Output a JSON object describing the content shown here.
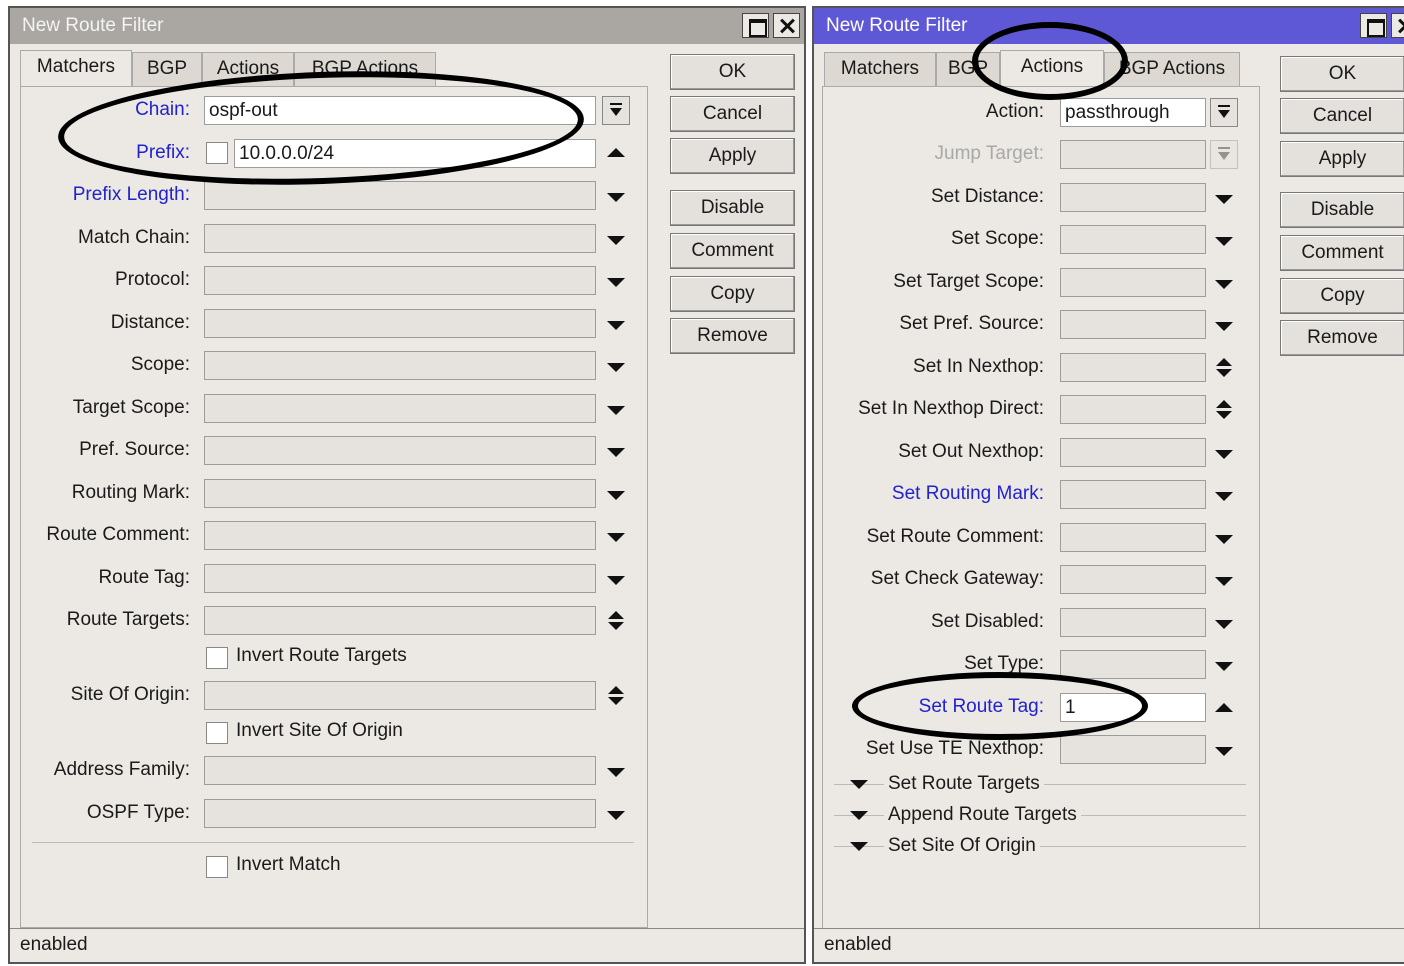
{
  "left_window": {
    "title": "New Route Filter",
    "tabs": [
      "Matchers",
      "BGP",
      "Actions",
      "BGP Actions"
    ],
    "active_tab": "Matchers",
    "fields": {
      "chain": {
        "label": "Chain:",
        "value": "ospf-out"
      },
      "prefix": {
        "label": "Prefix:",
        "value": "10.0.0.0/24"
      },
      "prefix_length": {
        "label": "Prefix Length:",
        "value": ""
      },
      "match_chain": {
        "label": "Match Chain:",
        "value": ""
      },
      "protocol": {
        "label": "Protocol:",
        "value": ""
      },
      "distance": {
        "label": "Distance:",
        "value": ""
      },
      "scope": {
        "label": "Scope:",
        "value": ""
      },
      "target_scope": {
        "label": "Target Scope:",
        "value": ""
      },
      "pref_source": {
        "label": "Pref. Source:",
        "value": ""
      },
      "routing_mark": {
        "label": "Routing Mark:",
        "value": ""
      },
      "route_comment": {
        "label": "Route Comment:",
        "value": ""
      },
      "route_tag": {
        "label": "Route Tag:",
        "value": ""
      },
      "route_targets": {
        "label": "Route Targets:",
        "value": ""
      },
      "site_of_origin": {
        "label": "Site Of Origin:",
        "value": ""
      },
      "address_family": {
        "label": "Address Family:",
        "value": ""
      },
      "ospf_type": {
        "label": "OSPF Type:",
        "value": ""
      }
    },
    "checkboxes": {
      "invert_route_targets": "Invert Route Targets",
      "invert_site_of_origin": "Invert Site Of Origin",
      "invert_match": "Invert Match"
    },
    "buttons": [
      "OK",
      "Cancel",
      "Apply",
      "Disable",
      "Comment",
      "Copy",
      "Remove"
    ],
    "status": "enabled"
  },
  "right_window": {
    "title": "New Route Filter",
    "tabs": [
      "Matchers",
      "BGP",
      "Actions",
      "BGP Actions"
    ],
    "active_tab": "Actions",
    "fields": {
      "action": {
        "label": "Action:",
        "value": "passthrough"
      },
      "jump_target": {
        "label": "Jump Target:",
        "value": ""
      },
      "set_distance": {
        "label": "Set Distance:",
        "value": ""
      },
      "set_scope": {
        "label": "Set Scope:",
        "value": ""
      },
      "set_target_scope": {
        "label": "Set Target Scope:",
        "value": ""
      },
      "set_pref_source": {
        "label": "Set Pref. Source:",
        "value": ""
      },
      "set_in_nexthop": {
        "label": "Set In Nexthop:",
        "value": ""
      },
      "set_in_nexthop_direct": {
        "label": "Set In Nexthop Direct:",
        "value": ""
      },
      "set_out_nexthop": {
        "label": "Set Out Nexthop:",
        "value": ""
      },
      "set_routing_mark": {
        "label": "Set Routing Mark:",
        "value": ""
      },
      "set_route_comment": {
        "label": "Set Route Comment:",
        "value": ""
      },
      "set_check_gateway": {
        "label": "Set Check Gateway:",
        "value": ""
      },
      "set_disabled": {
        "label": "Set Disabled:",
        "value": ""
      },
      "set_type": {
        "label": "Set Type:",
        "value": ""
      },
      "set_route_tag": {
        "label": "Set Route Tag:",
        "value": "1"
      },
      "set_use_te_nexthop": {
        "label": "Set Use TE Nexthop:",
        "value": ""
      }
    },
    "sections": [
      "Set Route Targets",
      "Append Route Targets",
      "Set Site Of Origin"
    ],
    "buttons": [
      "OK",
      "Cancel",
      "Apply",
      "Disable",
      "Comment",
      "Copy",
      "Remove"
    ],
    "status": "enabled"
  },
  "colors": {
    "active_title": "#5e58d6",
    "inactive_title": "#aaa7a3",
    "highlight_label": "#2222cc",
    "window_bg": "#ece9e4"
  }
}
